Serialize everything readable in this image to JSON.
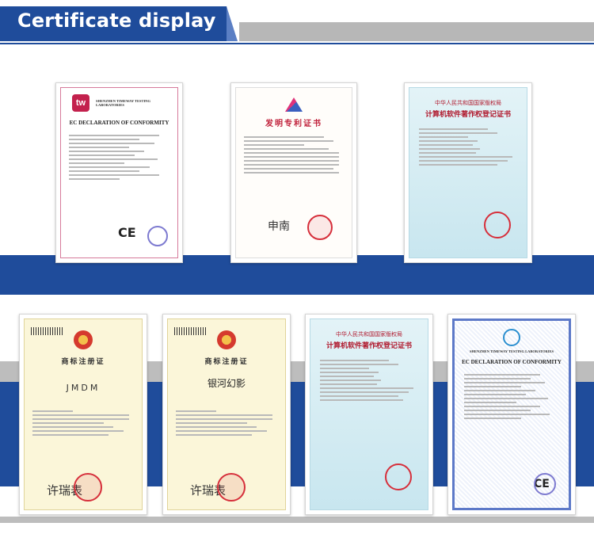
{
  "header": {
    "title": "Certificate display"
  },
  "certificates": [
    {
      "kind": "EC Declaration",
      "logo": "tw",
      "lab": "SHENZHEN TIMEWAY TESTING LABORATORIES",
      "heading": "EC DECLARATION OF CONFORMITY",
      "mark": "CE"
    },
    {
      "kind": "Patent",
      "heading": "发明专利证书"
    },
    {
      "kind": "Software Copyright",
      "heading1": "中华人民共和国国家版权局",
      "heading2": "计算机软件著作权登记证书"
    },
    {
      "kind": "Trademark",
      "heading": "商标注册证",
      "brand": "JMDM"
    },
    {
      "kind": "Trademark",
      "heading": "商标注册证",
      "brand": "银河幻影"
    },
    {
      "kind": "Software Copyright",
      "heading1": "中华人民共和国国家版权局",
      "heading2": "计算机软件著作权登记证书"
    },
    {
      "kind": "EC Declaration",
      "lab": "SHENZHEN TIMEWAY TESTING LABORATORIES",
      "heading": "EC DECLARATION OF CONFORMITY",
      "mark": "CE"
    }
  ],
  "colors": {
    "brand_blue": "#1f4c9b",
    "band_grey": "#bdbdbd"
  }
}
